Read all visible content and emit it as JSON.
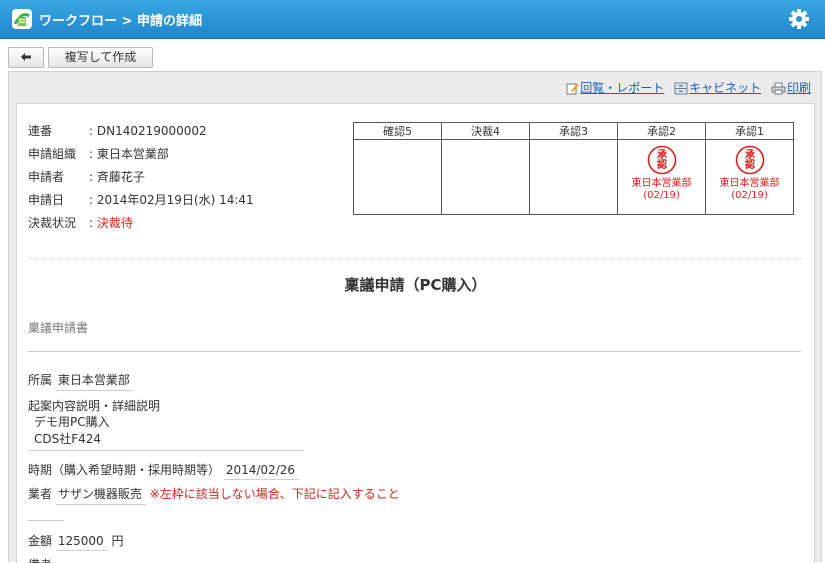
{
  "header": {
    "title": "ワークフロー > 申請の詳細"
  },
  "toolbar": {
    "back_label": "",
    "copy_label": "複写して作成"
  },
  "actions": [
    {
      "label": "回覧・レポート",
      "icon": "report-icon"
    },
    {
      "label": "キャビネット",
      "icon": "cabinet-icon"
    },
    {
      "label": "印刷",
      "icon": "print-icon"
    }
  ],
  "info": [
    {
      "label": "連番",
      "value": ": DN140219000002"
    },
    {
      "label": "申請組織",
      "value": ": 東日本営業部"
    },
    {
      "label": "申請者",
      "value": ": 斉藤花子"
    },
    {
      "label": "申請日",
      "value": ": 2014年02月19日(水) 14:41"
    },
    {
      "label": "決裁状況",
      "value_prefix": ": ",
      "value": "決裁待"
    }
  ],
  "approval": {
    "headers": [
      "確認5",
      "決裁4",
      "承認3",
      "承認2",
      "承認1"
    ],
    "stamps": [
      {
        "col": 3,
        "text": "承認",
        "dept": "東日本営業部",
        "date": "(02/19)"
      },
      {
        "col": 4,
        "text": "承認",
        "dept": "東日本営業部",
        "date": "(02/19)"
      }
    ]
  },
  "form": {
    "title": "稟議申請（PC購入）",
    "subtitle": "稟議申請書",
    "dept_label": "所属",
    "dept_value": "東日本営業部",
    "desc_label": "起案内容説明・詳細説明",
    "desc_lines": [
      "デモ用PC購入",
      "CDS社F424"
    ],
    "timing_label": "時期（購入希望時期・採用時期等）",
    "timing_value": "2014/02/26",
    "vendor_label": "業者",
    "vendor_value": "サザン機器販売",
    "vendor_note": "※左枠に該当しない場合、下記に記入すること",
    "amount_label": "金額",
    "amount_value": "125000",
    "amount_unit": "円",
    "notes_label": "備考"
  },
  "colors": {
    "header": "#2a96d8",
    "link": "#1f5fb6",
    "alert": "#e0201a"
  }
}
